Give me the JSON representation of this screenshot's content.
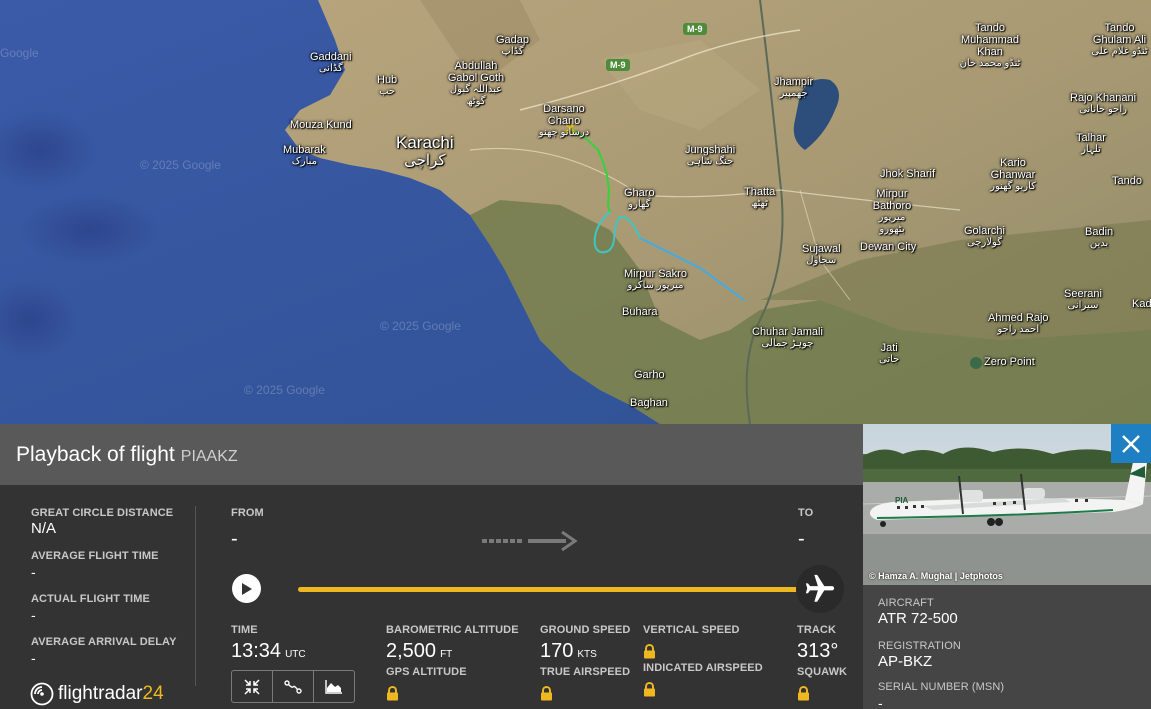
{
  "map": {
    "watermark": "© 2025 Google",
    "watermark_small": "Google",
    "roads": [
      "M-9",
      "M-9"
    ],
    "places": [
      {
        "name": "Gadap",
        "urdu": "گڈاپ"
      },
      {
        "name": "Gaddani",
        "urdu": "گڈانی"
      },
      {
        "name": "Abdullah Gabol Goth",
        "urdu": "عبداللہ گبول گوٹھ"
      },
      {
        "name": "Hub",
        "urdu": "حب"
      },
      {
        "name": "Mouza Kund",
        "urdu": ""
      },
      {
        "name": "Karachi",
        "urdu": "کراچی"
      },
      {
        "name": "Mubarak",
        "urdu": "مبارک"
      },
      {
        "name": "Darsano Chano",
        "urdu": "درسانو چھنو"
      },
      {
        "name": "Jhampir",
        "urdu": "جھمپیر"
      },
      {
        "name": "Jungshahi",
        "urdu": "جنگ شاہی"
      },
      {
        "name": "Gharo",
        "urdu": "گھارو"
      },
      {
        "name": "Thatta",
        "urdu": "ٹھٹھ"
      },
      {
        "name": "Mirpur Sakro",
        "urdu": "میرپور ساکرو"
      },
      {
        "name": "Buhara",
        "urdu": ""
      },
      {
        "name": "Garho",
        "urdu": ""
      },
      {
        "name": "Baghan",
        "urdu": ""
      },
      {
        "name": "Chuhar Jamali",
        "urdu": "چوہڑ جمالی"
      },
      {
        "name": "Sujawal",
        "urdu": "سجاول"
      },
      {
        "name": "Dewan City",
        "urdu": ""
      },
      {
        "name": "Jati",
        "urdu": "جاتی"
      },
      {
        "name": "Mirpur Bathoro",
        "urdu": "میرپور بٹھورو"
      },
      {
        "name": "Jhok Sharif",
        "urdu": ""
      },
      {
        "name": "Kario Ghanwar",
        "urdu": "کاریو گھنور"
      },
      {
        "name": "Golarchi",
        "urdu": "گولارچی"
      },
      {
        "name": "Ahmed Rajo",
        "urdu": "احمد راجو"
      },
      {
        "name": "Zero Point",
        "urdu": ""
      },
      {
        "name": "Tando Muhammad Khan",
        "urdu": "ٹنڈو محمد خان"
      },
      {
        "name": "Tando Ghulam Ali",
        "urdu": "ٹنڈو غلام علی"
      },
      {
        "name": "Rajo Khanani",
        "urdu": "راجو خانانی"
      },
      {
        "name": "Talhar",
        "urdu": "تلہار"
      },
      {
        "name": "Tando",
        "urdu": ""
      },
      {
        "name": "Badin",
        "urdu": "بدین"
      },
      {
        "name": "Seerani",
        "urdu": "سیرانی"
      },
      {
        "name": "Kad",
        "urdu": ""
      }
    ]
  },
  "panel": {
    "title": "Playback of flight",
    "callsign": "PIAAKZ",
    "great_circle_distance": {
      "label": "GREAT CIRCLE DISTANCE",
      "value": "N/A"
    },
    "average_flight_time": {
      "label": "AVERAGE FLIGHT TIME",
      "value": "-"
    },
    "actual_flight_time": {
      "label": "ACTUAL FLIGHT TIME",
      "value": "-"
    },
    "average_arrival_delay": {
      "label": "AVERAGE ARRIVAL DELAY",
      "value": "-"
    },
    "from": {
      "label": "FROM",
      "value": "-"
    },
    "to": {
      "label": "TO",
      "value": "-"
    },
    "playback_progress": 1.0,
    "time": {
      "label": "TIME",
      "value": "13:34",
      "unit": "UTC"
    },
    "barometric_altitude": {
      "label": "BAROMETRIC ALTITUDE",
      "value": "2,500",
      "unit": "FT"
    },
    "gps_altitude": {
      "label": "GPS ALTITUDE",
      "locked": true
    },
    "ground_speed": {
      "label": "GROUND SPEED",
      "value": "170",
      "unit": "KTS"
    },
    "true_airspeed": {
      "label": "TRUE AIRSPEED",
      "locked": true
    },
    "vertical_speed": {
      "label": "VERTICAL SPEED",
      "locked": true
    },
    "indicated_airspeed": {
      "label": "INDICATED AIRSPEED",
      "locked": true
    },
    "track": {
      "label": "TRACK",
      "value": "313°"
    },
    "squawk": {
      "label": "SQUAWK",
      "locked": true
    },
    "tools": [
      "fit-view-icon",
      "route-icon",
      "chart-icon"
    ],
    "logo": {
      "text": "flightradar",
      "num": "24"
    }
  },
  "aircraft": {
    "photo_credit": "© Hamza A. Mughal | Jetphotos",
    "aircraft": {
      "label": "AIRCRAFT",
      "value": "ATR 72-500"
    },
    "registration": {
      "label": "REGISTRATION",
      "value": "AP-BKZ"
    },
    "serial_number": {
      "label": "SERIAL NUMBER (MSN)",
      "value": "-"
    },
    "livery_text": "PIA"
  },
  "colors": {
    "accent": "#f0b820",
    "close": "#1f7fc3",
    "track_start": "#34d33a",
    "track_end": "#4aa8e0",
    "marker": "#f0d020"
  }
}
